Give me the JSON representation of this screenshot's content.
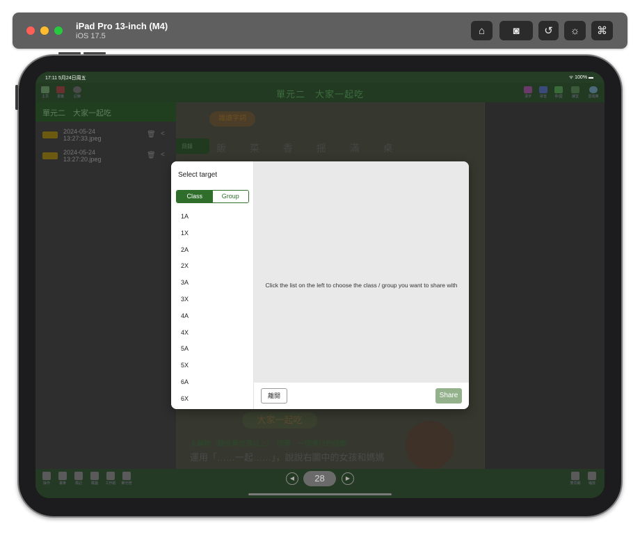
{
  "simulator": {
    "device_name": "iPad Pro 13-inch (M4)",
    "os_version": "iOS 17.5",
    "toolbar_icons": [
      "home-icon",
      "screenshot-icon",
      "rotate-icon",
      "brightness-icon",
      "command-icon"
    ]
  },
  "status_bar": {
    "time": "17:11  5月24日周五",
    "battery": "ᯤ 100% ▬"
  },
  "app": {
    "title": "單元二　大家一起吃",
    "top_left_labels": [
      "主頁",
      "書籤",
      "記錄"
    ],
    "top_right_labels": [
      "漢字",
      "拼音",
      "粵/國",
      "課堂",
      "雲端庫"
    ],
    "sidebar": {
      "header": "單元二　大家一起吃",
      "files": [
        {
          "date": "2024-05-24",
          "time": "13:27:33.jpeg"
        },
        {
          "date": "2024-05-24",
          "time": "13:27:20.jpeg"
        }
      ]
    },
    "page": {
      "chip": "識讀字詞",
      "tab": "目錄",
      "characters": "飯 菜 香 揺 滿 桌",
      "lower_title": "大家一起吃",
      "line1": "人稱物（關係單位頂以上）　同學，一同進行的話動",
      "line2": "運用「……一起……」，說說右圖中的女孩和媽媽"
    },
    "bottom_tools": [
      "操作",
      "畫筆",
      "標記",
      "截圖",
      "工作紙",
      "聚光燈"
    ],
    "bottom_right_labels": [
      "雙頁顯",
      "縮放"
    ],
    "page_number": "28"
  },
  "modal": {
    "title": "Select target",
    "segments": {
      "class": "Class",
      "group": "Group",
      "active": "Class"
    },
    "classes": [
      "1A",
      "1X",
      "2A",
      "2X",
      "3A",
      "3X",
      "4A",
      "4X",
      "5A",
      "5X",
      "6A",
      "6X"
    ],
    "hint": "Click the list on the left to choose the class / group you want to share with",
    "leave_label": "離開",
    "share_label": "Share"
  },
  "colors": {
    "primary_green": "#2f6e2a",
    "share_disabled": "#93b28c"
  }
}
